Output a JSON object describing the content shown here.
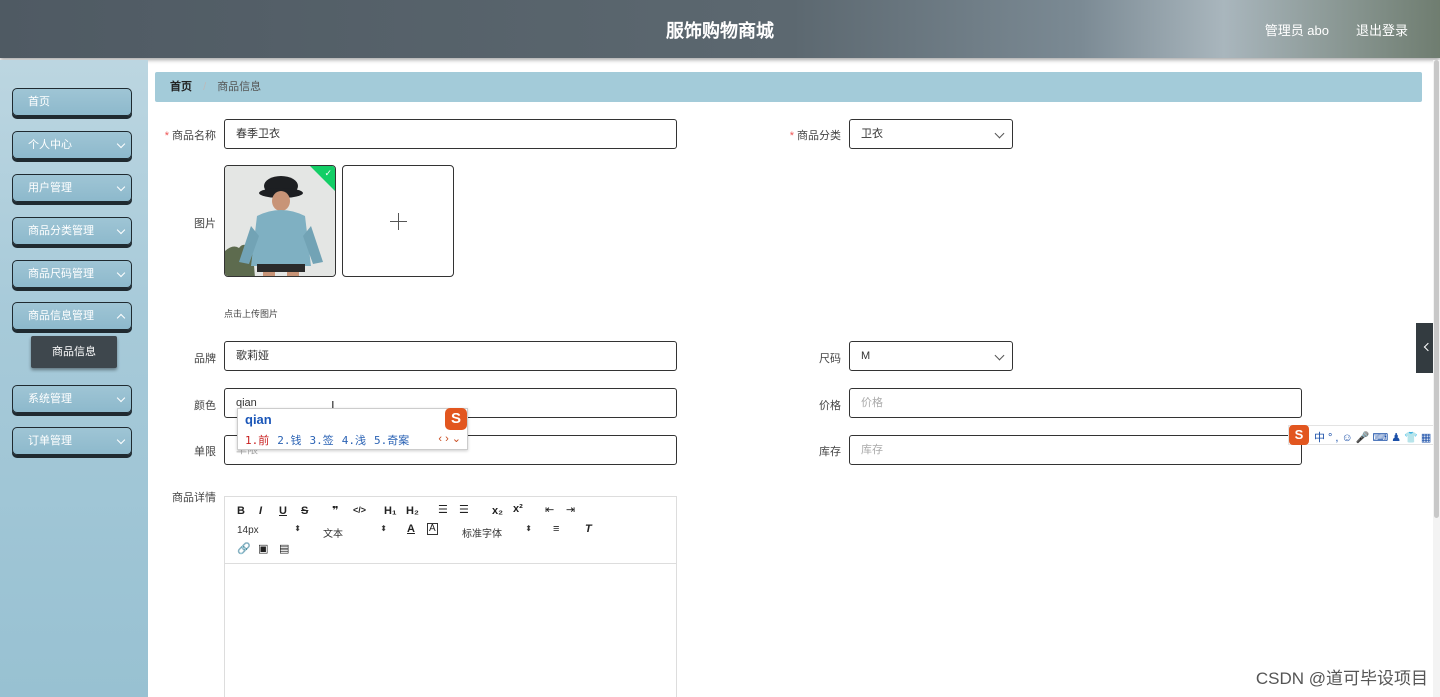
{
  "header": {
    "title": "服饰购物商城",
    "user": "管理员 abo",
    "logout": "退出登录"
  },
  "sidebar": {
    "items": [
      {
        "label": "首页"
      },
      {
        "label": "个人中心"
      },
      {
        "label": "用户管理"
      },
      {
        "label": "商品分类管理"
      },
      {
        "label": "商品尺码管理"
      },
      {
        "label": "商品信息管理"
      },
      {
        "label": "系统管理"
      },
      {
        "label": "订单管理"
      }
    ],
    "active_sub": "商品信息"
  },
  "breadcrumb": {
    "home": "首页",
    "current": "商品信息"
  },
  "form": {
    "name_label": "商品名称",
    "name_value": "春季卫衣",
    "category_label": "商品分类",
    "category_value": "卫衣",
    "image_label": "图片",
    "upload_hint": "点击上传图片",
    "brand_label": "品牌",
    "brand_value": "歌莉娅",
    "size_label": "尺码",
    "size_value": "M",
    "color_label": "颜色",
    "color_value": "qian",
    "price_label": "价格",
    "price_placeholder": "价格",
    "limit_label": "单限",
    "limit_placeholder": "单限",
    "stock_label": "库存",
    "stock_placeholder": "库存",
    "detail_label": "商品详情"
  },
  "ime": {
    "composition": "qian",
    "candidates": [
      "1.前",
      "2.钱",
      "3.签",
      "4.浅",
      "5.奇案"
    ],
    "logo": "S"
  },
  "editor": {
    "font_size": "14px",
    "text_type": "文本",
    "font_family": "标准字体"
  },
  "ime_bar": {
    "logo": "S",
    "mode": "中"
  },
  "watermark": "CSDN @道可毕设项目"
}
